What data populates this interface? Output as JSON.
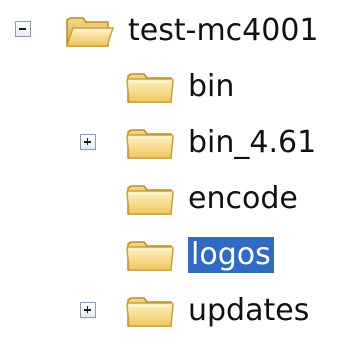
{
  "tree": {
    "root": {
      "label": "test-mc4001",
      "expander": "minus",
      "icon": "open-folder-icon"
    },
    "children": [
      {
        "label": "bin",
        "expander": "none",
        "icon": "folder-icon",
        "selected": false
      },
      {
        "label": "bin_4.61",
        "expander": "plus",
        "icon": "folder-icon",
        "selected": false
      },
      {
        "label": "encode",
        "expander": "none",
        "icon": "folder-icon",
        "selected": false
      },
      {
        "label": "logos",
        "expander": "none",
        "icon": "folder-icon",
        "selected": true
      },
      {
        "label": "updates",
        "expander": "plus",
        "icon": "folder-icon",
        "selected": false
      }
    ]
  },
  "colors": {
    "selection": "#316ac5",
    "folder": "#f5d27a",
    "folder_edge": "#c9a13e"
  }
}
